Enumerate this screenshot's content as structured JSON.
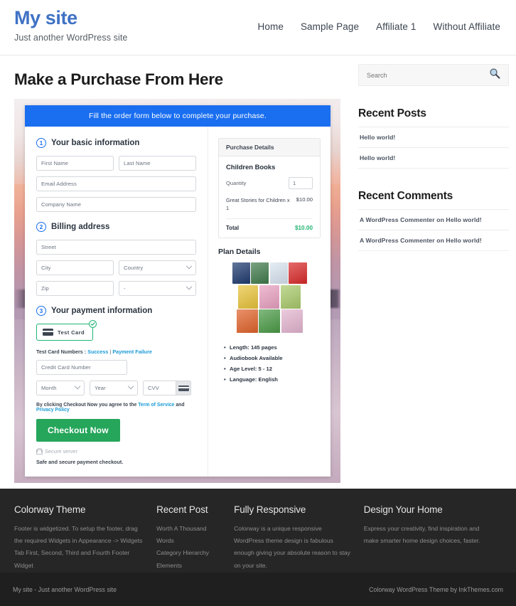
{
  "header": {
    "site_title": "My site",
    "tagline": "Just another WordPress site",
    "nav": [
      {
        "label": "Home"
      },
      {
        "label": "Sample Page"
      },
      {
        "label": "Affiliate 1"
      },
      {
        "label": "Without Affiliate"
      }
    ]
  },
  "main": {
    "page_title": "Make a Purchase From Here",
    "order_banner": "Fill the order form below to complete your purchase.",
    "steps": {
      "basic": {
        "num": "1",
        "title": "Your basic information"
      },
      "billing": {
        "num": "2",
        "title": "Billing address"
      },
      "payment": {
        "num": "3",
        "title": "Your payment information"
      }
    },
    "fields": {
      "first_name": "First Name",
      "last_name": "Last Name",
      "email": "Email Address",
      "company": "Company Name",
      "street": "Street",
      "city": "City",
      "country": "Country",
      "zip": "Zip",
      "state": "-",
      "credit_card": "Credit Card Number",
      "month": "Month",
      "year": "Year",
      "cvv": "CVV"
    },
    "payment_method": {
      "label": "Test Card",
      "selected": true
    },
    "test_card": {
      "prefix": "Test Card Numbers : ",
      "success": "Success",
      "separator": " | ",
      "failure": "Payment Failure"
    },
    "terms": {
      "before": "By clicking Checkout Now you agree to the ",
      "tos": "Term of Service",
      "middle": " and ",
      "privacy": "Privacy Policy"
    },
    "checkout_button": "Checkout Now",
    "secure_server": "Secure server",
    "safe_note": "Safe and secure payment checkout."
  },
  "purchase": {
    "header": "Purchase Details",
    "product": "Children Books",
    "quantity_label": "Quantity",
    "quantity_value": "1",
    "line_item": "Great Stories for Children x 1",
    "line_amount": "$10.00",
    "total_label": "Total",
    "total_amount": "$10.00",
    "plan_title": "Plan Details",
    "plan_details": [
      "Length: 145 pages",
      "Audiobook Available",
      "Age Level: 5 - 12",
      "Language: English"
    ],
    "book_covers": [
      {
        "title": "Cinderella",
        "color": "#1e3a6e"
      },
      {
        "title": "Hansel & Gretel",
        "color": "#3f7a4a"
      },
      {
        "title": "The Princess and the Pea",
        "color": "#d8e3ef"
      },
      {
        "title": "Rumpelstiltskin",
        "color": "#d92a2a"
      },
      {
        "title": "Jack and the Beanstalk",
        "color": "#e8c33a"
      },
      {
        "title": "Sleeping Beauty",
        "color": "#e8a0c0"
      },
      {
        "title": "Goldilocks and the Three Bears",
        "color": "#a8c96a"
      },
      {
        "title": "The Frog Prince",
        "color": "#e0622a"
      },
      {
        "title": "Little Red Riding Hood",
        "color": "#4a9a46"
      },
      {
        "title": "Snow White",
        "color": "#e3b4cf"
      }
    ]
  },
  "sidebar": {
    "search_placeholder": "Search",
    "recent_posts_title": "Recent Posts",
    "recent_posts": [
      {
        "label": "Hello world!"
      },
      {
        "label": "Hello world!"
      }
    ],
    "recent_comments_title": "Recent Comments",
    "recent_comments": [
      {
        "label": "A WordPress Commenter on Hello world!"
      },
      {
        "label": "A WordPress Commenter on Hello world!"
      }
    ]
  },
  "footer": {
    "columns": [
      {
        "title": "Colorway Theme",
        "text": "Footer is widgetized. To setup the footer, drag the required Widgets in Appearance -> Widgets Tab First, Second, Third and Fourth Footer Widget"
      },
      {
        "title": "Recent Post",
        "items": [
          {
            "label": "Worth A Thousand Words"
          },
          {
            "label": "Category Hierarchy"
          },
          {
            "label": "Elements"
          }
        ]
      },
      {
        "title": "Fully Responsive",
        "text": "Colorway is a unique responsive WordPress theme design is fabulous enough giving your absolute reason to stay on your site."
      },
      {
        "title": "Design Your Home",
        "text": "Express your creativity, find inspiration and make smarter home design choices, faster."
      }
    ],
    "copyright_left": "My site - Just another WordPress site",
    "copyright_right": "Colorway WordPress Theme by InkThemes.com"
  },
  "colors": {
    "brand_blue": "#3f72c4",
    "banner_blue": "#1a6ef0",
    "checkout_green": "#26a65b",
    "total_green": "#21b573",
    "link_blue": "#1a9bd7",
    "footer_dark": "#262626"
  }
}
